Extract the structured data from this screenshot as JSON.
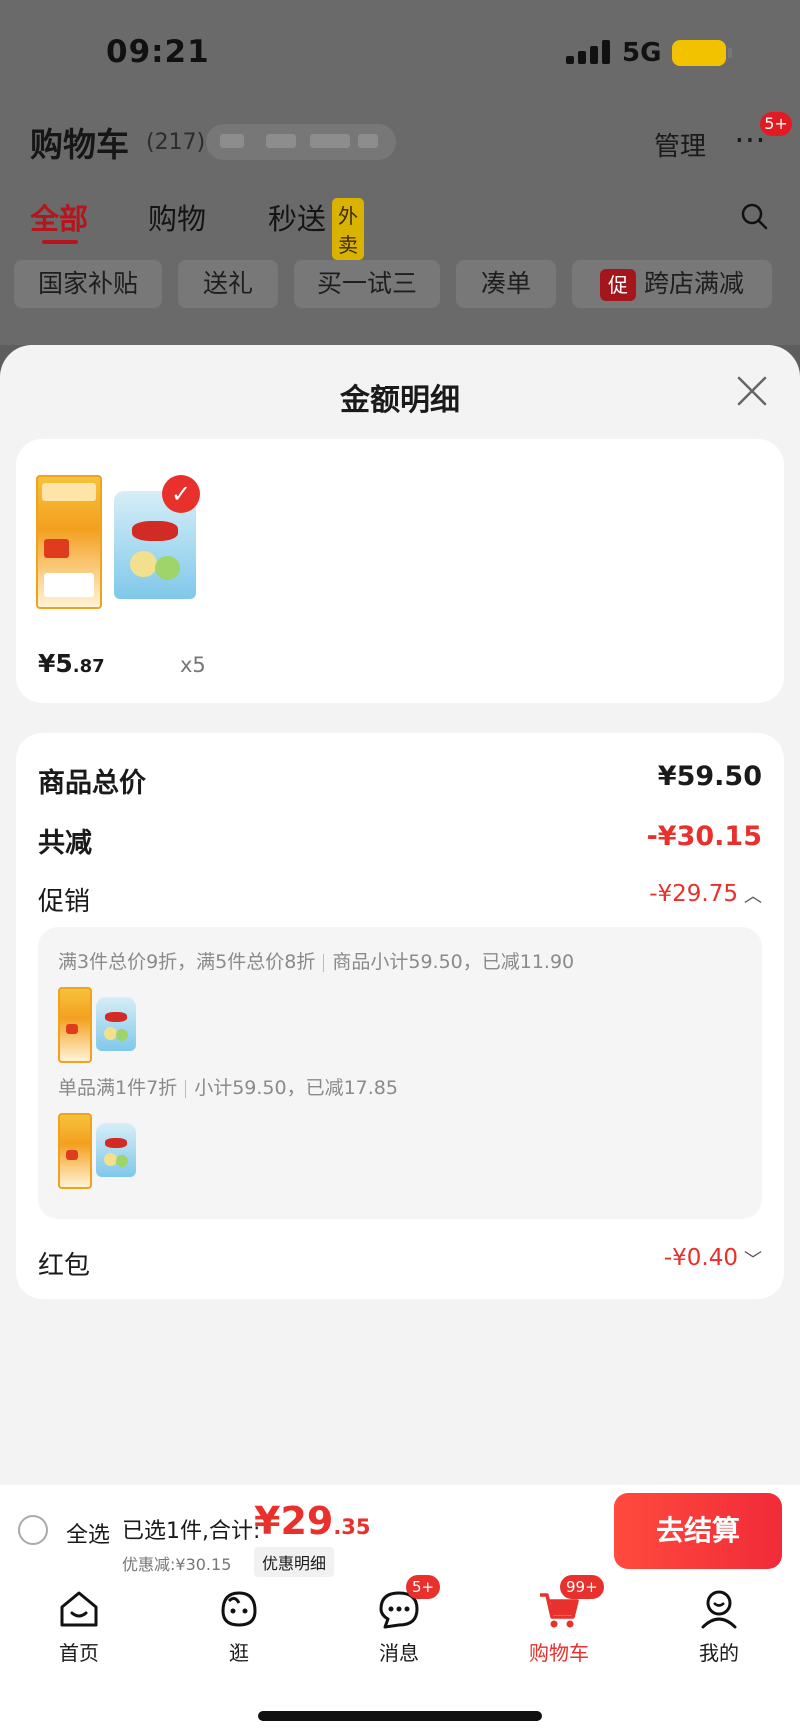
{
  "status_bar": {
    "time": "09:21",
    "network": "5G"
  },
  "cart_header": {
    "title": "购物车",
    "count": "(217)",
    "manage": "管理",
    "more_badge": "5+"
  },
  "top_tabs": [
    {
      "label": "全部"
    },
    {
      "label": "购物"
    },
    {
      "label": "秒送"
    }
  ],
  "waimai_tag": "外卖",
  "filter_chips": [
    {
      "label": "国家补贴"
    },
    {
      "label": "送礼"
    },
    {
      "label": "买一试三"
    },
    {
      "label": "凑单"
    },
    {
      "label": "跨店满减",
      "icon_text": "促"
    }
  ],
  "sheet": {
    "title": "金额明细",
    "product": {
      "price_int": "¥5",
      "price_dec": ".87",
      "qty": "x5"
    },
    "summary": {
      "total_label": "商品总价",
      "total_value": "¥59.50",
      "reduce_label": "共减",
      "reduce_value": "-¥30.15",
      "promo_label": "促销",
      "promo_value": "-¥29.75",
      "redpack_label": "红包",
      "redpack_value": "-¥0.40"
    },
    "promo_rules": [
      {
        "desc": "满3件总价9折，满5件总价8折",
        "detail": "商品小计59.50，已减11.90"
      },
      {
        "desc": "单品满1件7折",
        "detail": "小计59.50，已减17.85"
      }
    ]
  },
  "checkout": {
    "select_all": "全选",
    "selected_text": "已选1件,合计:",
    "total_int": "¥29",
    "total_dec": ".35",
    "discount_text": "优惠减:¥30.15",
    "discount_detail_btn": "优惠明细",
    "checkout_btn": "去结算"
  },
  "tabbar": [
    {
      "label": "首页",
      "icon": "home-icon"
    },
    {
      "label": "逛",
      "icon": "browse-face-icon"
    },
    {
      "label": "消息",
      "icon": "message-icon",
      "badge": "5+"
    },
    {
      "label": "购物车",
      "icon": "cart-icon",
      "badge": "99+",
      "active": true
    },
    {
      "label": "我的",
      "icon": "profile-icon"
    }
  ],
  "colors": {
    "accent": "#e8302c",
    "dark_red": "#b5151b",
    "sheet_bg": "#f3f3f3"
  }
}
